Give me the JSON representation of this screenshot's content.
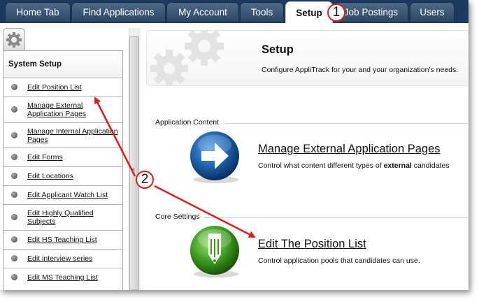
{
  "nav": {
    "tabs": [
      {
        "label": "Home Tab"
      },
      {
        "label": "Find Applications"
      },
      {
        "label": "My Account"
      },
      {
        "label": "Tools"
      },
      {
        "label": "Setup"
      },
      {
        "label": "Job Postings"
      },
      {
        "label": "Users"
      }
    ],
    "active_tab": "Setup"
  },
  "sidebar": {
    "gear_tab_icon": "gear-icon",
    "title": "System Setup",
    "items": [
      {
        "label": "Edit Position List"
      },
      {
        "label": "Manage External Application Pages"
      },
      {
        "label": "Manage Internal Application Pages"
      },
      {
        "label": "Edit Forms"
      },
      {
        "label": "Edit Locations"
      },
      {
        "label": "Edit Applicant Watch List"
      },
      {
        "label": "Edit Highly Qualified Subjects"
      },
      {
        "label": "Edit HS Teaching List"
      },
      {
        "label": "Edit interview series"
      },
      {
        "label": "Edit MS Teaching List"
      }
    ]
  },
  "main": {
    "header": {
      "title": "Setup",
      "description": "Configure AppliTrack for your and your organization's needs."
    },
    "sections": [
      {
        "label": "Application Content",
        "link": "Manage External Application Pages",
        "desc_prefix": "Control what content different types of ",
        "desc_bold": "external",
        "desc_suffix": " candidates",
        "icon": "arrow-right-icon"
      },
      {
        "label": "Core Settings",
        "link": "Edit The Position List",
        "desc": "Control application pools that candidates can use.",
        "icon": "pencil-icon"
      }
    ]
  },
  "callouts": {
    "one": "1",
    "two": "2"
  },
  "colors": {
    "nav_bg": "#1b3a5e",
    "tab_bg": "#3b5878",
    "callout_red": "#d81f1f",
    "blue_icon": "#1a5fa8",
    "green_icon": "#3b9a1e"
  }
}
